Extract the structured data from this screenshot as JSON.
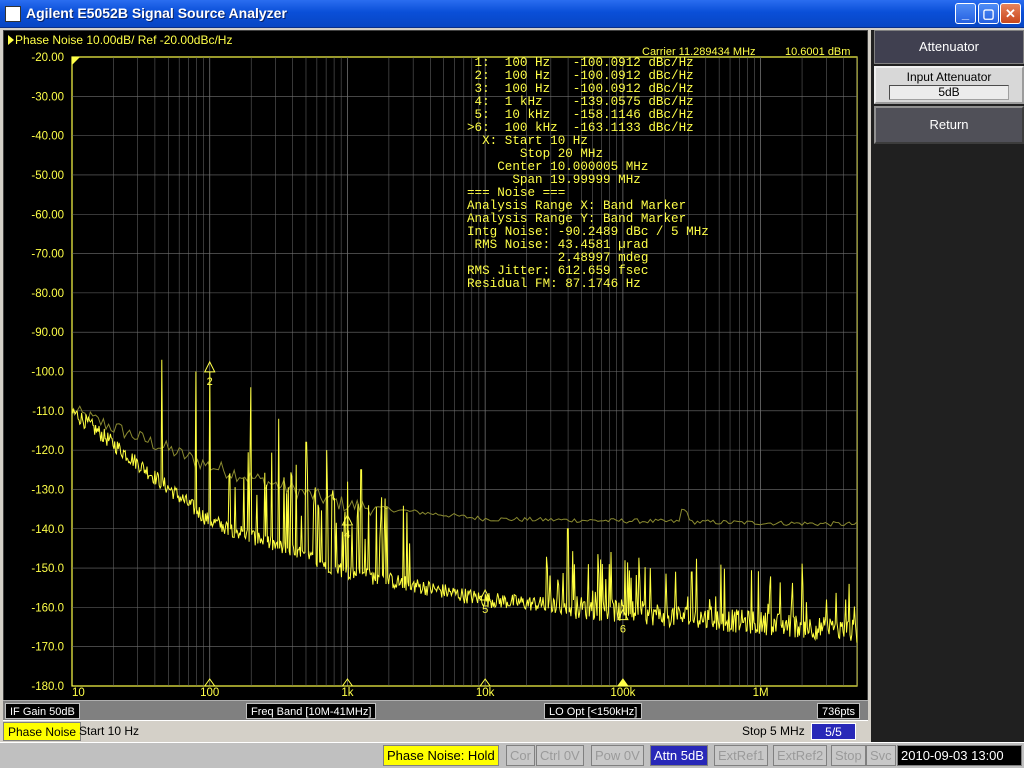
{
  "window": {
    "title": "Agilent E5052B Signal Source Analyzer",
    "icon": "scope-icon",
    "buttons": {
      "min": "_",
      "max": "▢",
      "close": "✕"
    }
  },
  "trace": {
    "header": "Phase Noise 10.00dB/ Ref -20.00dBc/Hz",
    "carrier": "Carrier 11.289434 MHz",
    "carrier_level": "10.6001 dBm",
    "y_labels": [
      "-20.00",
      "-30.00",
      "-40.00",
      "-50.00",
      "-60.00",
      "-70.00",
      "-80.00",
      "-90.00",
      "-100.0",
      "-110.0",
      "-120.0",
      "-130.0",
      "-140.0",
      "-150.0",
      "-160.0",
      "-170.0",
      "-180.0"
    ],
    "x_labels": [
      "10",
      "100",
      "1k",
      "10k",
      "100k",
      "1M"
    ],
    "trace_color": "#ffff40",
    "ref_trace_color": "#8a8a30",
    "grid_color": "#707070"
  },
  "markers": {
    "lines": [
      " 1:  100 Hz   -100.0912 dBc/Hz",
      " 2:  100 Hz   -100.0912 dBc/Hz",
      " 3:  100 Hz   -100.0912 dBc/Hz",
      " 4:  1 kHz    -139.0575 dBc/Hz",
      " 5:  10 kHz   -158.1146 dBc/Hz",
      ">6:  100 kHz  -163.1133 dBc/Hz",
      "  X: Start 10 Hz",
      "       Stop 20 MHz",
      "    Center 10.000005 MHz",
      "      Span 19.99999 MHz",
      "=== Noise ===",
      "Analysis Range X: Band Marker",
      "Analysis Range Y: Band Marker",
      "Intg Noise: -90.2489 dBc / 5 MHz",
      " RMS Noise: 43.4581 µrad",
      "            2.48997 mdeg",
      "RMS Jitter: 612.659 fsec",
      "Residual FM: 87.1746 Hz"
    ],
    "points": [
      {
        "label": "2",
        "freq_hz": 100,
        "level_dbc": -100.0912
      },
      {
        "label": "4",
        "freq_hz": 1000,
        "level_dbc": -139.0575
      },
      {
        "label": "5",
        "freq_hz": 10000,
        "level_dbc": -158.1146
      },
      {
        "label": "6",
        "freq_hz": 100000,
        "level_dbc": -163.1133
      }
    ]
  },
  "info_bar": {
    "if_gain": "IF Gain 50dB",
    "freq_band": "Freq Band [10M-41MHz]",
    "lo_opt": "LO Opt [<150kHz]",
    "points": "736pts"
  },
  "sweep_bar": {
    "trace_status": "Phase Noise",
    "start": "Start 10 Hz",
    "stop": "Stop 5 MHz",
    "page": "5/5"
  },
  "softkeys": {
    "title": "Attenuator",
    "input_attenuator_label": "Input Attenuator",
    "input_attenuator_value": "5dB",
    "return_label": "Return"
  },
  "statusbar": {
    "mode": "Phase Noise: Hold",
    "cor": "Cor",
    "ctrl": "Ctrl  0V",
    "pow": "Pow  0V",
    "attn": "Attn 5dB",
    "extref1": "ExtRef1",
    "extref2": "ExtRef2",
    "stop": "Stop",
    "svc": "Svc",
    "datetime": "2010-09-03 13:00"
  }
}
